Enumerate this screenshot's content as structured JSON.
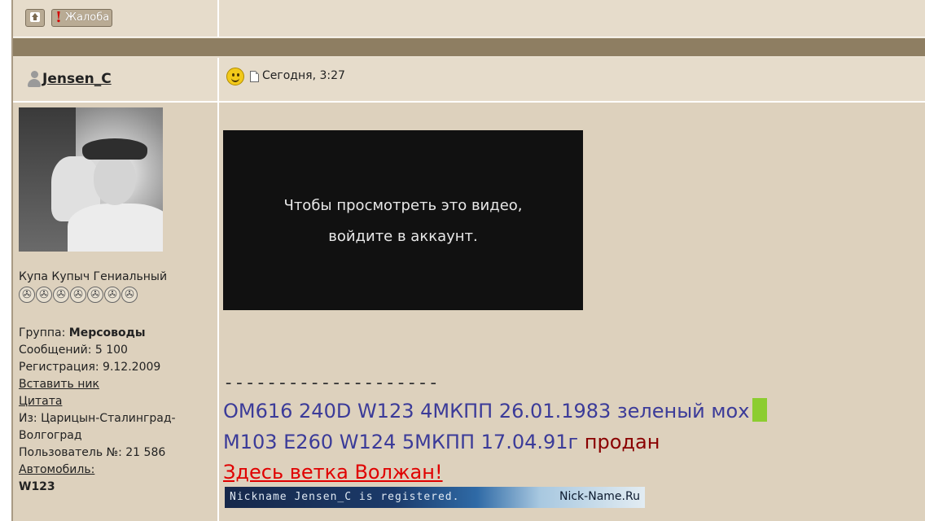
{
  "toolbar": {
    "complain_label": "Жалоба",
    "complain_mark": "!"
  },
  "post": {
    "author": "Jensen_C",
    "date": "Сегодня, 3:27",
    "video": {
      "line1": "Чтобы просмотреть это видео,",
      "line2": "войдите в аккаунт."
    },
    "signature": {
      "dashes": "--------------------",
      "car1": "OM616 240D W123 4МКПП 26.01.1983 зеленый мох",
      "car2": "M103 E260 W124 5МКПП 17.04.91г",
      "car2_status": "продан",
      "volga_link": "Здесь ветка Волжан! ",
      "banner_left": "Nickname Jensen_C is registered.",
      "banner_right": "Nick-Name.Ru"
    }
  },
  "profile": {
    "rank": "Купа Купыч Гениальный",
    "stars": 7,
    "group_label": "Группа: ",
    "group_value": "Мерсоводы",
    "messages": "Сообщений: 5 100",
    "registration": "Регистрация: 9.12.2009",
    "insert_nick": "Вставить ник",
    "quote": "Цитата",
    "location_line1": "Из: Царицын-Сталинград-",
    "location_line2": "Волгоград",
    "user_number": "Пользователь №: 21 586",
    "car_label": "Автомобиль:",
    "car_value": "W123"
  },
  "colors": {
    "frame_bg": "#e6dccb",
    "divider": "#8e7e62",
    "post_bg": "#ddd1bd",
    "sig_blue": "#3b3b99",
    "sold_red": "#8a0000",
    "link_red": "#e00000",
    "green_block": "#8ccd30"
  }
}
